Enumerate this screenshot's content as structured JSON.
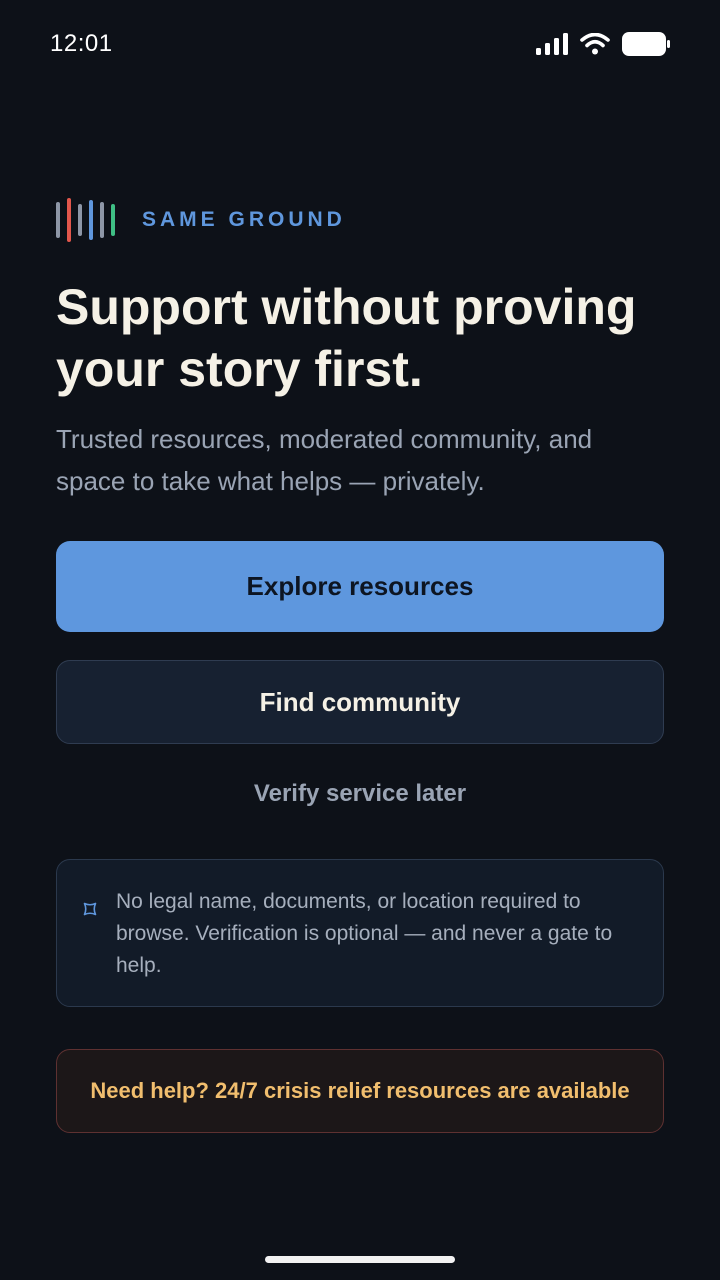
{
  "status_bar": {
    "time": "12:01"
  },
  "brand": {
    "name": "SAME GROUND",
    "logo_colors": [
      "#8d96a6",
      "#e2574c",
      "#8d96a6",
      "#5f97dd",
      "#8d96a6",
      "#3fbf85"
    ]
  },
  "hero": {
    "headline": "Support without proving your story first.",
    "subtitle": "Trusted resources, moderated community, and space to take what helps — privately."
  },
  "actions": {
    "primary_label": "Explore resources",
    "secondary_label": "Find community",
    "tertiary_label": "Verify service later"
  },
  "privacy_note": {
    "icon": "shield-icon",
    "text": "No legal name, documents, or location required to browse. Verification is optional — and never a gate to help."
  },
  "crisis": {
    "text": "Need help? 24/7 crisis relief resources are available"
  },
  "colors": {
    "background": "#0d1118",
    "accent": "#5e97de",
    "crisis_text": "#f1be6e",
    "crisis_border": "#5e3131"
  }
}
